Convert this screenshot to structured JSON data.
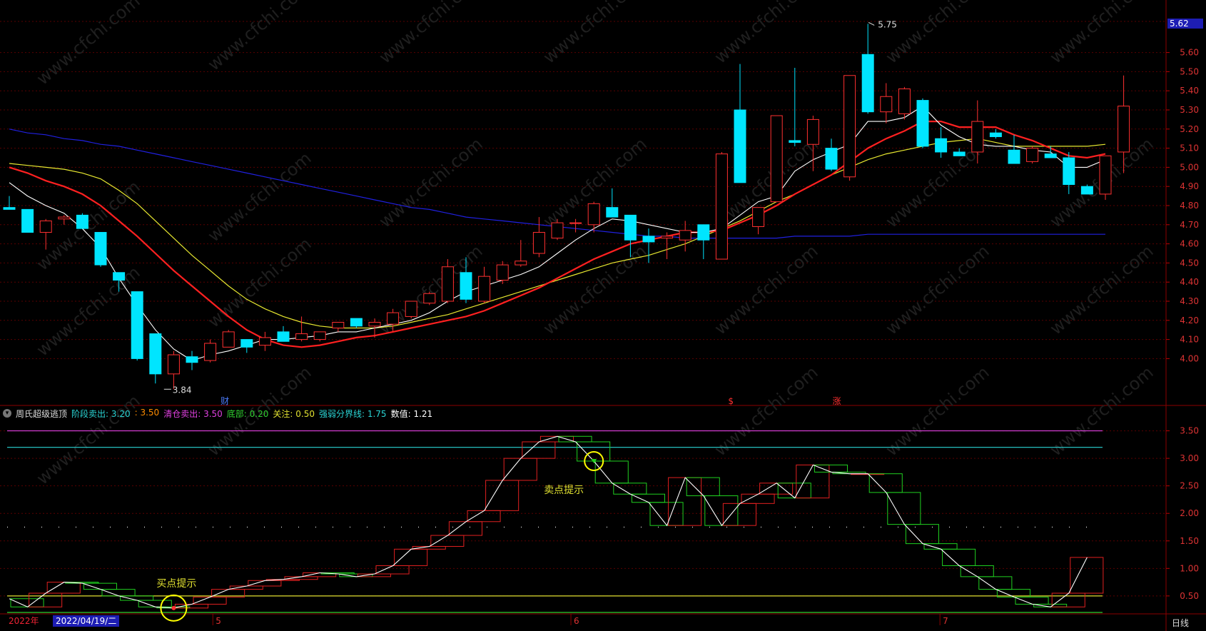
{
  "window": {
    "period_tab": "日线"
  },
  "price_panel": {
    "last_price_badge": "5.62",
    "y_ticks": [
      "5.60",
      "5.50",
      "5.40",
      "5.30",
      "5.20",
      "5.10",
      "5.00",
      "4.90",
      "4.80",
      "4.70",
      "4.60",
      "4.50",
      "4.40",
      "4.30",
      "4.20",
      "4.10",
      "4.00"
    ],
    "annotations": {
      "high_label": "5.75",
      "low_label": "3.84"
    },
    "event_markers": [
      {
        "label": "财",
        "color": "#4c7dff"
      },
      {
        "label": "$",
        "color": "#ff3030"
      },
      {
        "label": "涨",
        "color": "#ff3030"
      }
    ],
    "watermark": "www.cfchi.com"
  },
  "indicator_panel": {
    "name": "周氏超级逃顶",
    "params": [
      {
        "label": "阶段卖出:",
        "value": "3.20",
        "color": "#2ad4d4"
      },
      {
        "label": ":",
        "value": "3.50",
        "color": "#ff8c00"
      },
      {
        "label": "清仓卖出:",
        "value": "3.50",
        "color": "#e040e0"
      },
      {
        "label": "底部:",
        "value": "0.20",
        "color": "#30d030"
      },
      {
        "label": "关注:",
        "value": "0.50",
        "color": "#e0e030"
      },
      {
        "label": "强弱分界线:",
        "value": "1.75",
        "color": "#2ad4d4"
      },
      {
        "label": "数值:",
        "value": "1.21",
        "color": "#ffffff"
      }
    ],
    "y_ticks": [
      "3.50",
      "3.00",
      "2.50",
      "2.00",
      "1.50",
      "1.00",
      "0.50"
    ],
    "buy_hint": "买点提示",
    "sell_hint": "卖点提示"
  },
  "x_axis": {
    "year_label": "2022年",
    "cursor_date": "2022/04/19/二",
    "month_labels": [
      "5",
      "6",
      "7"
    ]
  },
  "colors": {
    "up": "#ff3030",
    "down": "#00e5ff",
    "ma5": "#ffffff",
    "ma10": "#ff2020",
    "ma20": "#e8e830",
    "ma250": "#2020e0",
    "grid": "#5a0000"
  },
  "chart_data": {
    "type": "candlestick",
    "price_ylim": [
      3.8,
      5.8
    ],
    "indicator_ylim": [
      0.2,
      3.65
    ],
    "candles": [
      {
        "o": 4.79,
        "h": 4.85,
        "l": 4.78,
        "c": 4.78
      },
      {
        "o": 4.78,
        "h": 4.78,
        "l": 4.66,
        "c": 4.66
      },
      {
        "o": 4.66,
        "h": 4.73,
        "l": 4.57,
        "c": 4.72
      },
      {
        "o": 4.73,
        "h": 4.75,
        "l": 4.7,
        "c": 4.74
      },
      {
        "o": 4.75,
        "h": 4.76,
        "l": 4.68,
        "c": 4.68
      },
      {
        "o": 4.66,
        "h": 4.66,
        "l": 4.48,
        "c": 4.49
      },
      {
        "o": 4.45,
        "h": 4.45,
        "l": 4.35,
        "c": 4.41
      },
      {
        "o": 4.35,
        "h": 4.35,
        "l": 3.99,
        "c": 4.0
      },
      {
        "o": 4.13,
        "h": 4.13,
        "l": 3.87,
        "c": 3.92
      },
      {
        "o": 3.92,
        "h": 4.04,
        "l": 3.84,
        "c": 4.02
      },
      {
        "o": 4.01,
        "h": 4.04,
        "l": 3.94,
        "c": 3.98
      },
      {
        "o": 3.99,
        "h": 4.1,
        "l": 3.98,
        "c": 4.08
      },
      {
        "o": 4.06,
        "h": 4.15,
        "l": 4.06,
        "c": 4.14
      },
      {
        "o": 4.1,
        "h": 4.1,
        "l": 4.03,
        "c": 4.06
      },
      {
        "o": 4.07,
        "h": 4.14,
        "l": 4.04,
        "c": 4.11
      },
      {
        "o": 4.14,
        "h": 4.17,
        "l": 4.09,
        "c": 4.09
      },
      {
        "o": 4.1,
        "h": 4.22,
        "l": 4.09,
        "c": 4.13
      },
      {
        "o": 4.1,
        "h": 4.14,
        "l": 4.09,
        "c": 4.14
      },
      {
        "o": 4.16,
        "h": 4.19,
        "l": 4.14,
        "c": 4.19
      },
      {
        "o": 4.21,
        "h": 4.21,
        "l": 4.16,
        "c": 4.17
      },
      {
        "o": 4.17,
        "h": 4.21,
        "l": 4.11,
        "c": 4.19
      },
      {
        "o": 4.18,
        "h": 4.26,
        "l": 4.14,
        "c": 4.24
      },
      {
        "o": 4.22,
        "h": 4.3,
        "l": 4.21,
        "c": 4.3
      },
      {
        "o": 4.29,
        "h": 4.35,
        "l": 4.28,
        "c": 4.34
      },
      {
        "o": 4.3,
        "h": 4.52,
        "l": 4.29,
        "c": 4.48
      },
      {
        "o": 4.45,
        "h": 4.53,
        "l": 4.29,
        "c": 4.31
      },
      {
        "o": 4.3,
        "h": 4.48,
        "l": 4.29,
        "c": 4.43
      },
      {
        "o": 4.41,
        "h": 4.51,
        "l": 4.39,
        "c": 4.49
      },
      {
        "o": 4.49,
        "h": 4.62,
        "l": 4.48,
        "c": 4.51
      },
      {
        "o": 4.55,
        "h": 4.74,
        "l": 4.53,
        "c": 4.66
      },
      {
        "o": 4.63,
        "h": 4.73,
        "l": 4.62,
        "c": 4.71
      },
      {
        "o": 4.71,
        "h": 4.73,
        "l": 4.66,
        "c": 4.71
      },
      {
        "o": 4.7,
        "h": 4.82,
        "l": 4.66,
        "c": 4.81
      },
      {
        "o": 4.79,
        "h": 4.89,
        "l": 4.75,
        "c": 4.74
      },
      {
        "o": 4.75,
        "h": 4.75,
        "l": 4.53,
        "c": 4.62
      },
      {
        "o": 4.64,
        "h": 4.68,
        "l": 4.5,
        "c": 4.61
      },
      {
        "o": 4.63,
        "h": 4.66,
        "l": 4.52,
        "c": 4.64
      },
      {
        "o": 4.62,
        "h": 4.72,
        "l": 4.56,
        "c": 4.67
      },
      {
        "o": 4.7,
        "h": 4.69,
        "l": 4.52,
        "c": 4.62
      },
      {
        "o": 4.52,
        "h": 5.08,
        "l": 4.52,
        "c": 5.07
      },
      {
        "o": 5.3,
        "h": 5.54,
        "l": 4.92,
        "c": 4.92
      },
      {
        "o": 4.69,
        "h": 4.79,
        "l": 4.65,
        "c": 4.79
      },
      {
        "o": 4.82,
        "h": 5.27,
        "l": 4.82,
        "c": 5.27
      },
      {
        "o": 5.14,
        "h": 5.52,
        "l": 5.11,
        "c": 5.13
      },
      {
        "o": 5.12,
        "h": 5.27,
        "l": 4.98,
        "c": 5.25
      },
      {
        "o": 5.1,
        "h": 5.15,
        "l": 4.98,
        "c": 4.99
      },
      {
        "o": 4.95,
        "h": 5.48,
        "l": 4.93,
        "c": 5.48
      },
      {
        "o": 5.59,
        "h": 5.75,
        "l": 5.28,
        "c": 5.29
      },
      {
        "o": 5.29,
        "h": 5.44,
        "l": 5.23,
        "c": 5.37
      },
      {
        "o": 5.28,
        "h": 5.42,
        "l": 5.25,
        "c": 5.41
      },
      {
        "o": 5.35,
        "h": 5.36,
        "l": 5.1,
        "c": 5.11
      },
      {
        "o": 5.15,
        "h": 5.21,
        "l": 5.05,
        "c": 5.08
      },
      {
        "o": 5.08,
        "h": 5.1,
        "l": 5.06,
        "c": 5.06
      },
      {
        "o": 5.08,
        "h": 5.35,
        "l": 5.02,
        "c": 5.24
      },
      {
        "o": 5.18,
        "h": 5.2,
        "l": 5.15,
        "c": 5.16
      },
      {
        "o": 5.09,
        "h": 5.17,
        "l": 5.02,
        "c": 5.02
      },
      {
        "o": 5.03,
        "h": 5.11,
        "l": 5.02,
        "c": 5.1
      },
      {
        "o": 5.07,
        "h": 5.11,
        "l": 5.05,
        "c": 5.05
      },
      {
        "o": 5.05,
        "h": 5.08,
        "l": 4.86,
        "c": 4.91
      },
      {
        "o": 4.9,
        "h": 4.91,
        "l": 4.86,
        "c": 4.86
      },
      {
        "o": 4.86,
        "h": 5.06,
        "l": 4.83,
        "c": 5.06
      },
      {
        "o": 5.08,
        "h": 5.48,
        "l": 4.97,
        "c": 5.32
      }
    ],
    "ma5": [
      4.92,
      4.85,
      4.8,
      4.76,
      4.68,
      4.58,
      4.42,
      4.28,
      4.15,
      4.05,
      3.99,
      4.02,
      4.04,
      4.07,
      4.1,
      4.1,
      4.11,
      4.12,
      4.14,
      4.14,
      4.16,
      4.18,
      4.2,
      4.24,
      4.3,
      4.35,
      4.38,
      4.41,
      4.44,
      4.48,
      4.55,
      4.62,
      4.68,
      4.73,
      4.72,
      4.7,
      4.68,
      4.66,
      4.66,
      4.68,
      4.75,
      4.82,
      4.85,
      4.98,
      5.04,
      5.08,
      5.12,
      5.24,
      5.24,
      5.26,
      5.32,
      5.22,
      5.16,
      5.12,
      5.11,
      5.11,
      5.09,
      5.08,
      5.0,
      5.0,
      5.04
    ],
    "ma10": [
      5.0,
      4.97,
      4.93,
      4.9,
      4.86,
      4.8,
      4.72,
      4.64,
      4.55,
      4.46,
      4.38,
      4.3,
      4.22,
      4.15,
      4.1,
      4.07,
      4.06,
      4.07,
      4.09,
      4.11,
      4.12,
      4.14,
      4.16,
      4.18,
      4.2,
      4.22,
      4.25,
      4.29,
      4.33,
      4.37,
      4.42,
      4.47,
      4.52,
      4.56,
      4.6,
      4.62,
      4.64,
      4.66,
      4.66,
      4.67,
      4.71,
      4.75,
      4.8,
      4.86,
      4.91,
      4.96,
      5.03,
      5.1,
      5.15,
      5.19,
      5.24,
      5.24,
      5.21,
      5.21,
      5.21,
      5.17,
      5.14,
      5.1,
      5.06,
      5.05,
      5.07
    ],
    "ma20": [
      5.02,
      5.01,
      5.0,
      4.99,
      4.97,
      4.94,
      4.88,
      4.81,
      4.72,
      4.63,
      4.54,
      4.46,
      4.38,
      4.31,
      4.26,
      4.22,
      4.19,
      4.17,
      4.16,
      4.16,
      4.16,
      4.17,
      4.19,
      4.21,
      4.23,
      4.26,
      4.29,
      4.32,
      4.35,
      4.38,
      4.41,
      4.44,
      4.47,
      4.5,
      4.52,
      4.54,
      4.57,
      4.6,
      4.64,
      4.68,
      4.72,
      4.77,
      4.82,
      4.86,
      4.91,
      4.96,
      5.0,
      5.04,
      5.07,
      5.09,
      5.11,
      5.13,
      5.14,
      5.15,
      5.13,
      5.11,
      5.11,
      5.11,
      5.11,
      5.11,
      5.12
    ],
    "ma250": [
      5.2,
      5.18,
      5.17,
      5.15,
      5.14,
      5.12,
      5.11,
      5.09,
      5.07,
      5.05,
      5.03,
      5.01,
      4.99,
      4.97,
      4.95,
      4.93,
      4.91,
      4.89,
      4.87,
      4.85,
      4.83,
      4.81,
      4.79,
      4.78,
      4.76,
      4.74,
      4.73,
      4.72,
      4.71,
      4.7,
      4.69,
      4.68,
      4.67,
      4.66,
      4.65,
      4.64,
      4.64,
      4.63,
      4.63,
      4.63,
      4.63,
      4.63,
      4.63,
      4.64,
      4.64,
      4.64,
      4.64,
      4.65,
      4.65,
      4.65,
      4.65,
      4.65,
      4.65,
      4.65,
      4.65,
      4.65,
      4.65,
      4.65,
      4.65,
      4.65,
      4.65
    ],
    "indicator": {
      "value": [
        0.45,
        0.3,
        0.55,
        0.75,
        0.73,
        0.62,
        0.5,
        0.42,
        0.3,
        0.28,
        0.35,
        0.48,
        0.62,
        0.68,
        0.78,
        0.8,
        0.85,
        0.92,
        0.9,
        0.85,
        0.9,
        1.05,
        1.35,
        1.4,
        1.6,
        1.85,
        2.05,
        2.6,
        3.0,
        3.3,
        3.4,
        3.3,
        2.95,
        2.55,
        2.35,
        2.2,
        1.78,
        2.65,
        2.32,
        1.78,
        2.18,
        2.35,
        2.55,
        2.28,
        2.88,
        2.75,
        2.72,
        2.72,
        2.38,
        1.8,
        1.45,
        1.35,
        1.05,
        0.85,
        0.62,
        0.48,
        0.35,
        0.3,
        0.55,
        1.2
      ],
      "levels": {
        "stage_sell": 3.2,
        "clear_sell": 3.5,
        "watch": 0.5,
        "bottom": 0.2,
        "strength": 1.75
      }
    }
  }
}
